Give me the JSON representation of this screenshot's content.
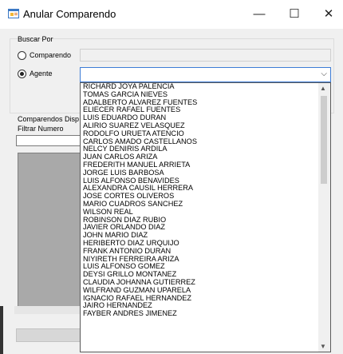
{
  "window": {
    "title": "Anular Comparendo",
    "controls": {
      "minimize": "—",
      "maximize": "☐",
      "close": "✕"
    }
  },
  "search": {
    "group_label": "Buscar Por",
    "option_comparendo": "Comparendo",
    "option_agente": "Agente",
    "selected": "Agente",
    "comparendo_value": "",
    "agente_value": ""
  },
  "left_panel": {
    "comparendos_label": "Comparendos Disp",
    "filter_label": "Filtrar Numero",
    "filter_value": ""
  },
  "agentes": [
    "RICHARD JOYA PALENCIA",
    "TOMAS GARCIA NIEVES",
    "ADALBERTO ALVAREZ FUENTES",
    "ELIECER RAFAEL FUENTES",
    "LUIS EDUARDO DURAN",
    "ALIRIO SUAREZ VELASQUEZ",
    "RODOLFO URUETA ATENCIO",
    "CARLOS AMADO CASTELLANOS",
    "NELCY DENIRIS ARDILA",
    "JUAN CARLOS ARIZA",
    "FREDERITH MANUEL ARRIETA",
    "JORGE LUIS BARBOSA",
    "LUIS ALFONSO BENAVIDES",
    "ALEXANDRA CAUSIL HERRERA",
    "JOSE CORTES OLIVEROS",
    "MARIO CUADROS SANCHEZ",
    "WILSON REAL",
    "ROBINSON DIAZ RUBIO",
    "JAVIER ORLANDO DIAZ",
    "JOHN MARIO DIAZ",
    "HERIBERTO DIAZ URQUIJO",
    "FRANK ANTONIO DURAN",
    "NIYIRETH FERREIRA ARIZA",
    "LUIS ALFONSO GOMEZ",
    "DEYSI GRILLO MONTANEZ",
    "CLAUDIA JOHANNA GUTIERREZ",
    "WILFRAND GUZMAN UPARELA",
    "IGNACIO RAFAEL HERNANDEZ",
    "JAIRO HERNANDEZ",
    "FAYBER ANDRES JIMENEZ"
  ],
  "colors": {
    "accent": "#3d7cd6",
    "grid": "#a9a9a9",
    "window_bg": "#f0f0f0"
  },
  "icons": {
    "app": "app-form-icon",
    "radio_selected": "radio-selected-icon"
  }
}
